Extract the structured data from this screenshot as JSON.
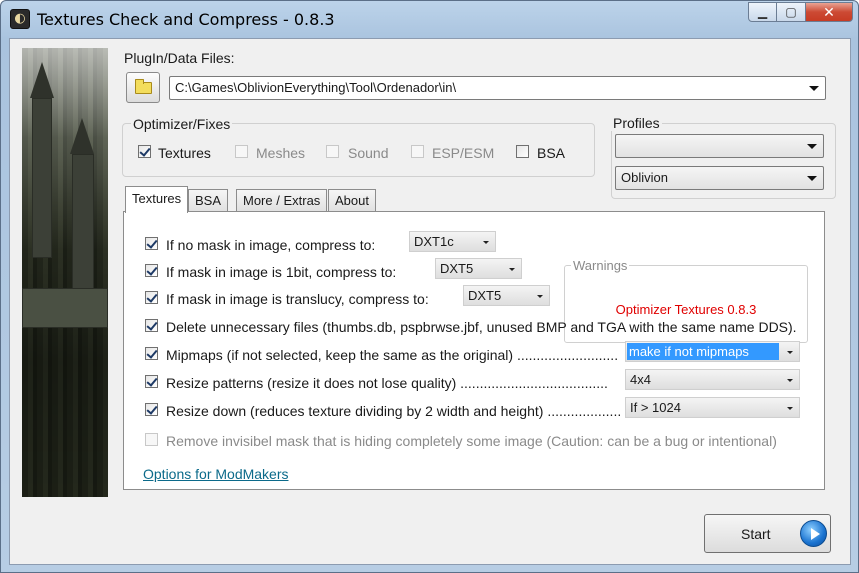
{
  "window": {
    "title": "Textures Check and Compress - 0.8.3"
  },
  "plugin": {
    "label": "PlugIn/Data Files:",
    "path": "C:\\Games\\OblivionEverything\\Tool\\Ordenador\\in\\"
  },
  "optimizer": {
    "label": "Optimizer/Fixes",
    "items": [
      {
        "label": "Textures",
        "checked": true,
        "enabled": true
      },
      {
        "label": "Meshes",
        "checked": false,
        "enabled": false
      },
      {
        "label": "Sound",
        "checked": false,
        "enabled": false
      },
      {
        "label": "ESP/ESM",
        "checked": false,
        "enabled": false
      },
      {
        "label": "BSA",
        "checked": false,
        "enabled": true
      }
    ]
  },
  "profiles": {
    "label": "Profiles",
    "profile_value": "",
    "game_value": "Oblivion"
  },
  "tabs": [
    {
      "label": "Textures",
      "active": true
    },
    {
      "label": "BSA",
      "active": false
    },
    {
      "label": "More / Extras",
      "active": false
    },
    {
      "label": "About",
      "active": false
    }
  ],
  "textures_tab": {
    "no_mask": {
      "label": "If no mask in image, compress to:",
      "value": "DXT1c",
      "checked": true
    },
    "mask_1bit": {
      "label": "If mask in image is 1bit, compress to:",
      "value": "DXT5",
      "checked": true
    },
    "mask_translucy": {
      "label": "If mask in image is translucy, compress to:",
      "value": "DXT5",
      "checked": true
    },
    "delete_files": {
      "label": "Delete unnecessary files (thumbs.db, pspbrwse.jbf, unused BMP and TGA with the same name DDS).",
      "checked": true
    },
    "mipmaps": {
      "label": "Mipmaps (if not selected, keep the same as the original) ..........................",
      "value": "make if not mipmaps",
      "checked": true
    },
    "resize_patterns": {
      "label": "Resize patterns (resize it does not lose quality) ......................................",
      "value": "4x4",
      "checked": true
    },
    "resize_down": {
      "label": "Resize down (reduces texture dividing by 2 width and height) ...................",
      "value": "If > 1024",
      "checked": true
    },
    "remove_mask": {
      "label": "Remove invisibel mask that is hiding completely some image (Caution: can be a bug or intentional)",
      "checked": false
    },
    "modmakers_link": "Options for ModMakers"
  },
  "warnings": {
    "title": "Warnings",
    "message": "Optimizer Textures 0.8.3"
  },
  "start_button": {
    "label": "Start"
  },
  "colors": {
    "warning_red": "#e00000",
    "link_teal": "#0b6a8a",
    "selection_blue": "#3399ff"
  }
}
